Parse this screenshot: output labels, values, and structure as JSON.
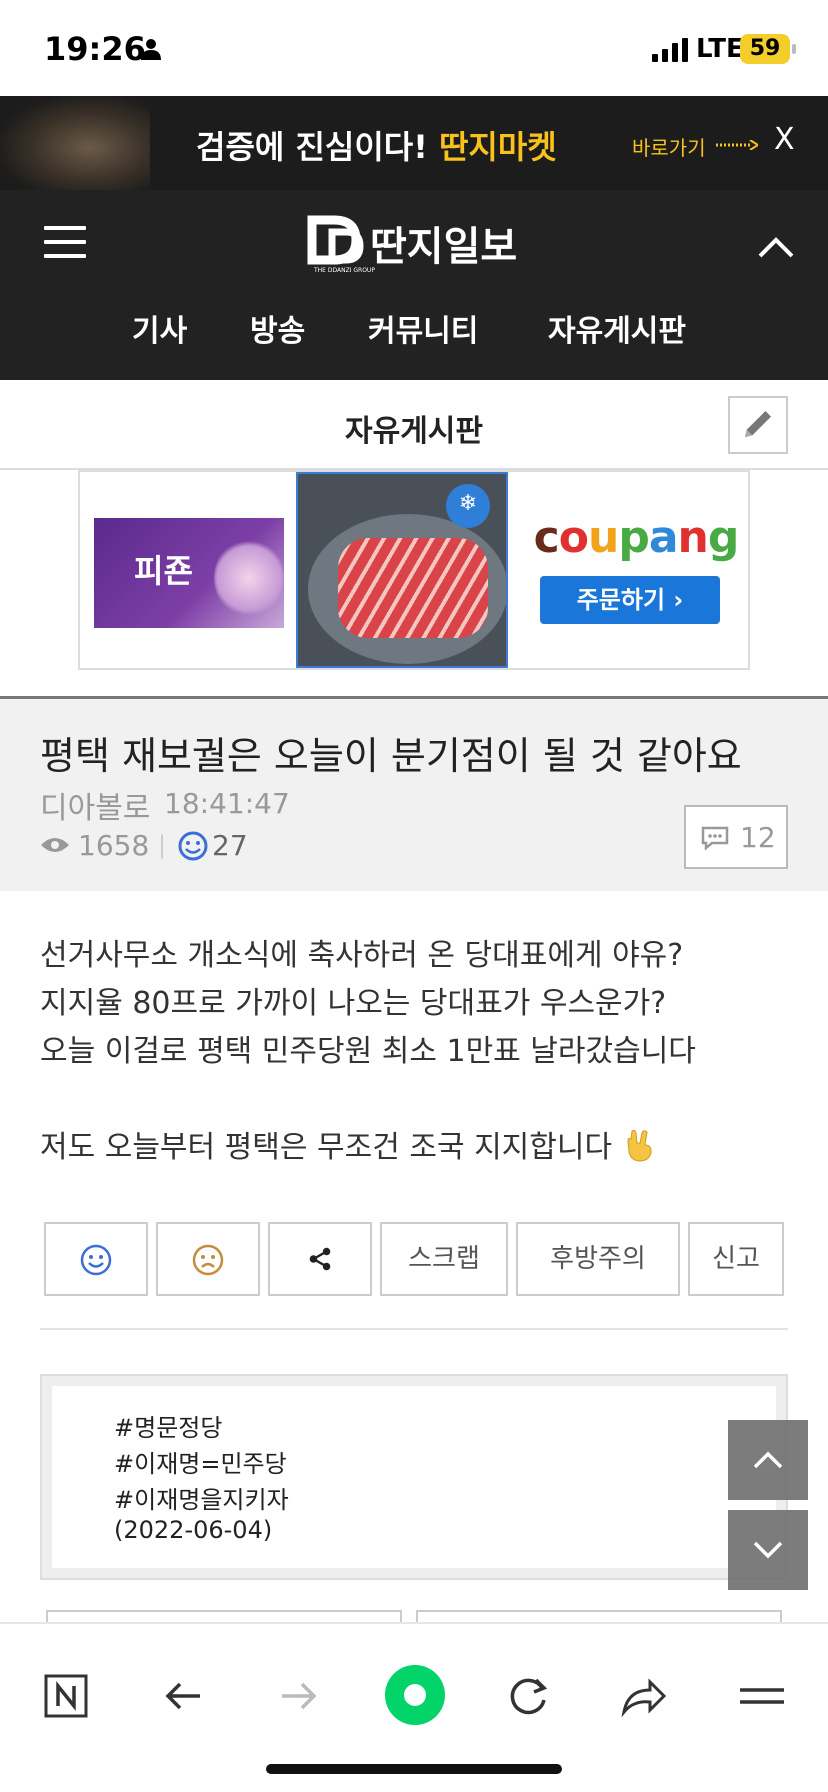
{
  "status": {
    "time": "19:26",
    "network": "LTE",
    "battery": "59"
  },
  "top_ad": {
    "message": "검증에 진심이다!",
    "brand": "딴지마켓",
    "go_label": "바로가기",
    "close_label": "X"
  },
  "header": {
    "logo_text": "딴지일보",
    "logo_subtext": "THE DDANZI GROUP",
    "nav": [
      "기사",
      "방송",
      "커뮤니티",
      "자유게시판"
    ]
  },
  "board": {
    "title": "자유게시판"
  },
  "ads": {
    "item1_text": "피죤",
    "item2_badge": "냉동",
    "coupang_logo": "coupang",
    "coupang_button": "주문하기 ›"
  },
  "post": {
    "title": "평택 재보궐은 오늘이 분기점이 될 것 같아요",
    "author": "디아볼로",
    "time": "18:41:47",
    "views": "1658",
    "likes": "27",
    "comments": "12",
    "body_lines": [
      "선거사무소 개소식에 축사하러 온 당대표에게 야유?",
      "지지율 80프로 가까이 나오는 당대표가 우스운가?",
      "오늘 이걸로 평택 민주당원 최소 1만표 날라갔습니다",
      "",
      "저도 오늘부터 평택은 무조건 조국 지지합니다"
    ]
  },
  "actions": {
    "scrap": "스크랩",
    "warning": "후방주의",
    "report": "신고"
  },
  "tags": [
    "#명문정당",
    "#이재명=민주당",
    "#이재명을지키자",
    "(2022-06-04)"
  ],
  "colors": {
    "header_bg": "#222222",
    "accent_yellow": "#f7c21b",
    "coupang_blue": "#1a76d8",
    "naver_green": "#03d46a"
  }
}
